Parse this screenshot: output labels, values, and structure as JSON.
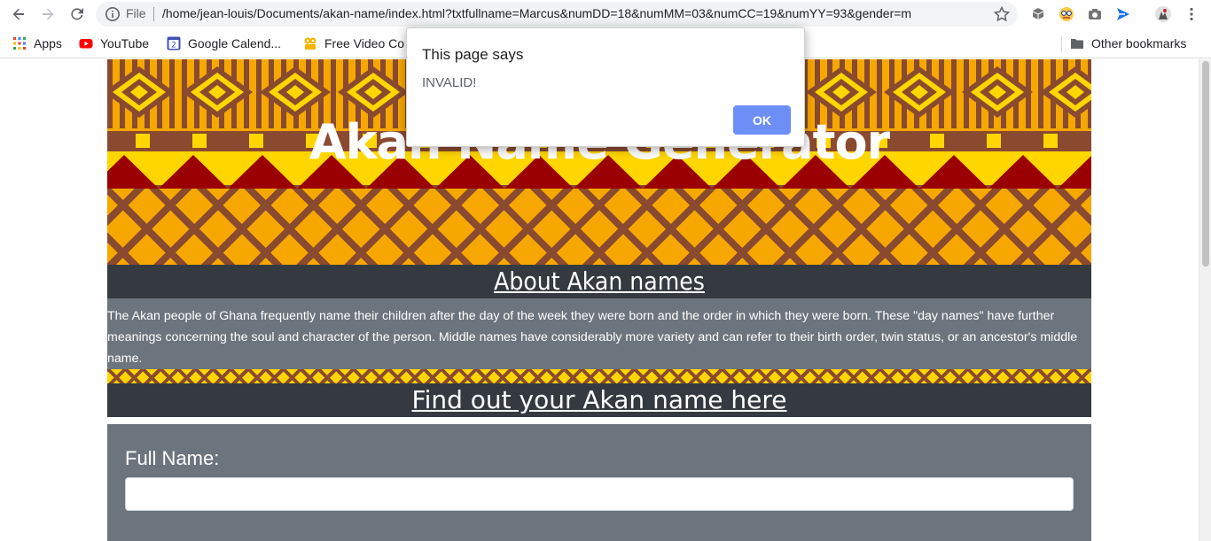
{
  "browser": {
    "scheme_label": "File",
    "url": "/home/jean-louis/Documents/akan-name/index.html?txtfullname=Marcus&numDD=18&numMM=03&numCC=19&numYY=93&gender=m",
    "bookmarks": [
      {
        "label": "Apps",
        "icon": "apps-grid-icon"
      },
      {
        "label": "YouTube",
        "icon": "youtube-icon"
      },
      {
        "label": "Google Calend...",
        "icon": "google-calendar-icon"
      },
      {
        "label": "Free Video Co",
        "icon": "video-converter-icon"
      }
    ],
    "other_bookmarks": "Other bookmarks"
  },
  "page": {
    "hero_title": "Akan Name Generator",
    "about_title": "About Akan names",
    "about_text": "The Akan people of Ghana frequently name their children after the day of the week they were born and the order in which they were born. These \"day names\" have further meanings concerning the soul and character of the person. Middle names have considerably more variety and can refer to their birth order, twin status, or an ancestor's middle name.",
    "find_title": "Find out your Akan name here",
    "form": {
      "fullname_label": "Full Name:",
      "fullname_value": ""
    }
  },
  "dialog": {
    "title": "This page says",
    "message": "INVALID!",
    "ok_label": "OK"
  },
  "colors": {
    "dark_bar": "#343a40",
    "gray_panel": "#6c757d",
    "kente_yellow": "#ffd600",
    "kente_orange": "#f6a800",
    "kente_brown": "#8a4a2f",
    "kente_red": "#9b0000",
    "dialog_button": "#6e8ef7"
  }
}
